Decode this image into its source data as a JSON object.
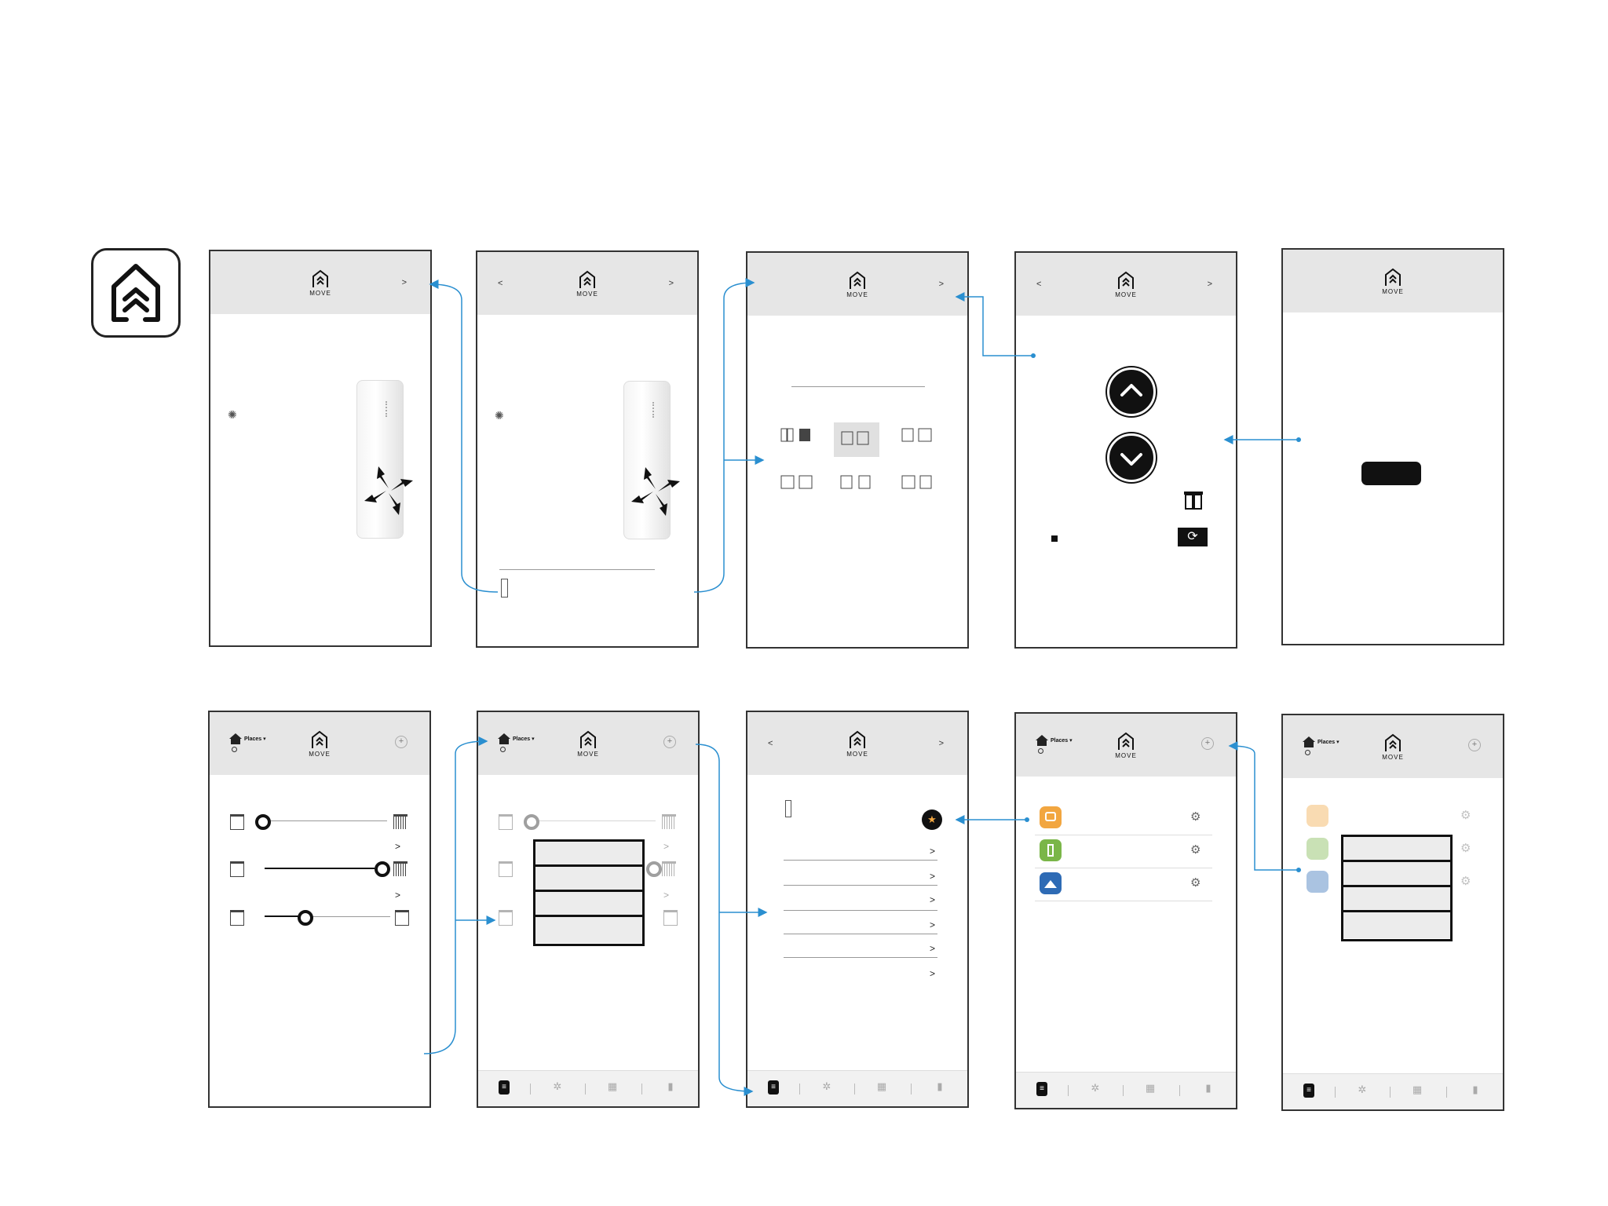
{
  "app": {
    "name": "MOVE"
  },
  "screens": {
    "s1": {
      "logo": "MOVE",
      "next": ">"
    },
    "s2": {
      "logo": "MOVE",
      "back": "<",
      "next": ">"
    },
    "s3": {
      "logo": "MOVE",
      "next": ">"
    },
    "s4": {
      "logo": "MOVE",
      "back": "<",
      "next": ">"
    },
    "s5": {
      "logo": "MOVE"
    },
    "s6": {
      "logo": "MOVE",
      "places": "Places",
      "plus": "+",
      "rows": [
        {
          "chev": ""
        },
        {
          "chev": ">"
        },
        {
          "chev": ">"
        }
      ]
    },
    "s7": {
      "logo": "MOVE",
      "places": "Places",
      "plus": "+",
      "rows": [
        {
          "chev": ""
        },
        {
          "chev": ">"
        },
        {
          "chev": ">"
        }
      ]
    },
    "s8": {
      "logo": "MOVE",
      "back": "<",
      "next": ">",
      "list_chevrons": [
        ">",
        ">",
        ">",
        ">",
        ">",
        ">"
      ]
    },
    "s9": {
      "logo": "MOVE",
      "places": "Places",
      "plus": "+"
    },
    "s10": {
      "logo": "MOVE",
      "places": "Places",
      "plus": "+"
    }
  },
  "colors": {
    "connector": "#2a8fd0",
    "place_orange": "#f2a640",
    "place_green": "#7ab648",
    "place_blue": "#2e6bb5"
  },
  "icons": [
    "app-logo-icon",
    "spinner-icon",
    "compress-arrows-icon",
    "chevron-up-icon",
    "chevron-down-icon",
    "curtain-icon",
    "sync-icon",
    "star-icon",
    "gear-icon",
    "house-icon"
  ]
}
